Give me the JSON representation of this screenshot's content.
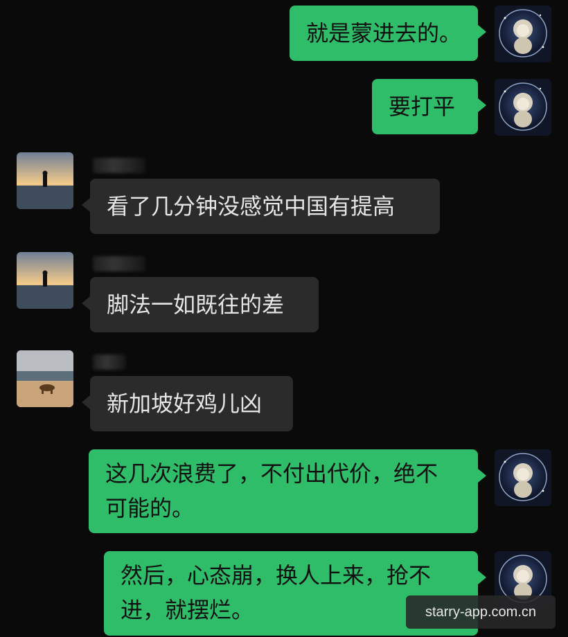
{
  "messages": [
    {
      "side": "out",
      "text": "就是蒙进去的。"
    },
    {
      "side": "out",
      "text": "要打平"
    },
    {
      "side": "in",
      "text": "看了几分钟没感觉中国有提高"
    },
    {
      "side": "in",
      "text": "脚法一如既往的差"
    },
    {
      "side": "in",
      "text": "新加坡好鸡儿凶"
    },
    {
      "side": "out",
      "text": "这几次浪费了，不付出代价，绝不\n可能的。"
    },
    {
      "side": "out",
      "text": "然后，心态崩，换人上来，抢不\n进，就摆烂。"
    }
  ],
  "watermark": "starry-app.com.cn",
  "colors": {
    "background": "#0a0a0a",
    "outgoing_bubble": "#2fbd6a",
    "incoming_bubble": "#2b2b2b"
  }
}
